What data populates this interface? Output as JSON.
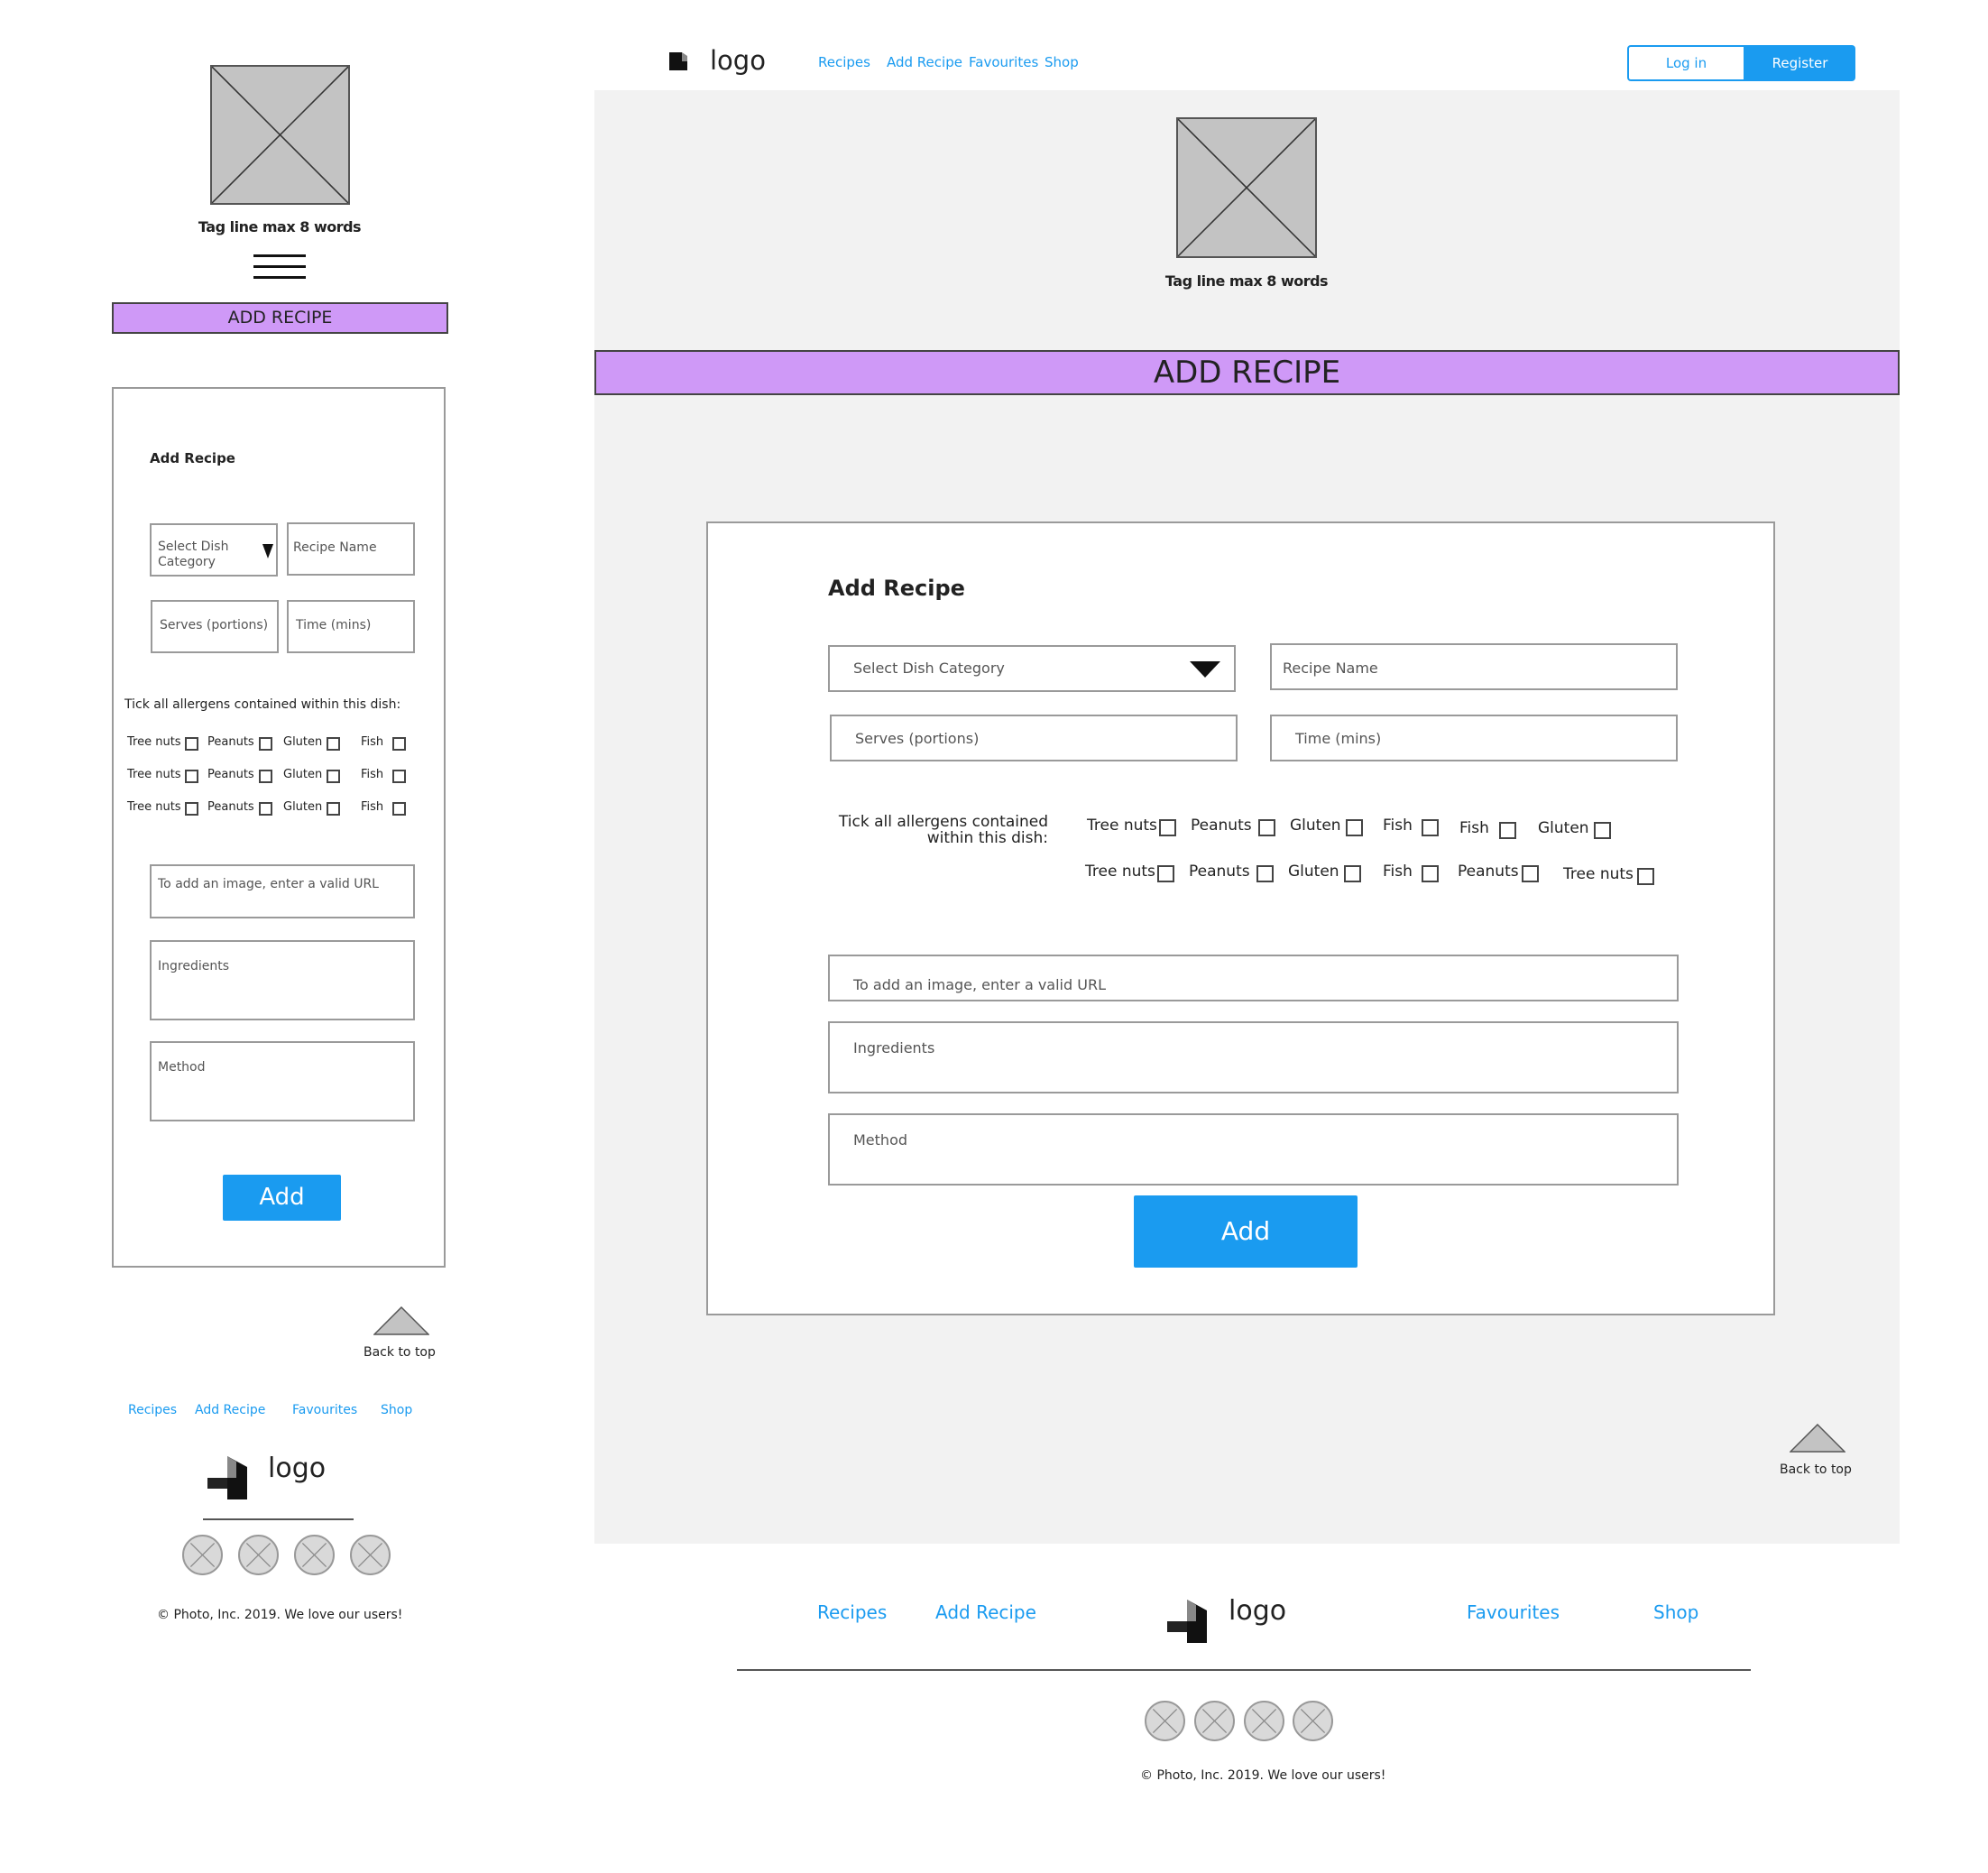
{
  "tagline": "Tag line max 8 words",
  "banner": "ADD RECIPE",
  "header": {
    "logo_text": "logo",
    "nav": [
      "Recipes",
      "Add Recipe",
      "Favourites",
      "Shop"
    ],
    "login": "Log in",
    "register": "Register"
  },
  "form": {
    "title": "Add Recipe",
    "category_placeholder": "Select Dish Category",
    "category_mobile_line1": "Select Dish",
    "category_mobile_line2": "Category",
    "recipe_name": "Recipe Name",
    "serves": "Serves (portions)",
    "time": "Time (mins)",
    "allergen_prompt": "Tick all allergens contained within this dish:",
    "allergen_prompt_line1": "Tick all allergens contained",
    "allergen_prompt_line2": "within this dish:",
    "image_url": "To add an image, enter a valid URL",
    "ingredients": "Ingredients",
    "method": "Method",
    "submit": "Add"
  },
  "allergens_mobile": [
    [
      "Tree nuts",
      "Peanuts",
      "Gluten",
      "Fish"
    ],
    [
      "Tree nuts",
      "Peanuts",
      "Gluten",
      "Fish"
    ],
    [
      "Tree nuts",
      "Peanuts",
      "Gluten",
      "Fish"
    ]
  ],
  "allergens_desktop": [
    [
      "Tree nuts",
      "Peanuts",
      "Gluten",
      "Fish",
      "Fish",
      "Gluten"
    ],
    [
      "Tree nuts",
      "Peanuts",
      "Gluten",
      "Fish",
      "Peanuts",
      "Tree nuts"
    ]
  ],
  "back_to_top": "Back to top",
  "footer": {
    "links": [
      "Recipes",
      "Add Recipe",
      "Favourites",
      "Shop"
    ],
    "logo_text": "logo",
    "copyright": "© Photo, Inc. 2019. We love our users!",
    "social_icons": [
      "social-icon-1",
      "social-icon-2",
      "social-icon-3",
      "social-icon-4"
    ]
  },
  "colors": {
    "accent_blue": "#1a9bf0",
    "banner_purple": "#cf99f7",
    "canvas_gray": "#f2f2f2",
    "placeholder_gray": "#c3c3c3"
  }
}
